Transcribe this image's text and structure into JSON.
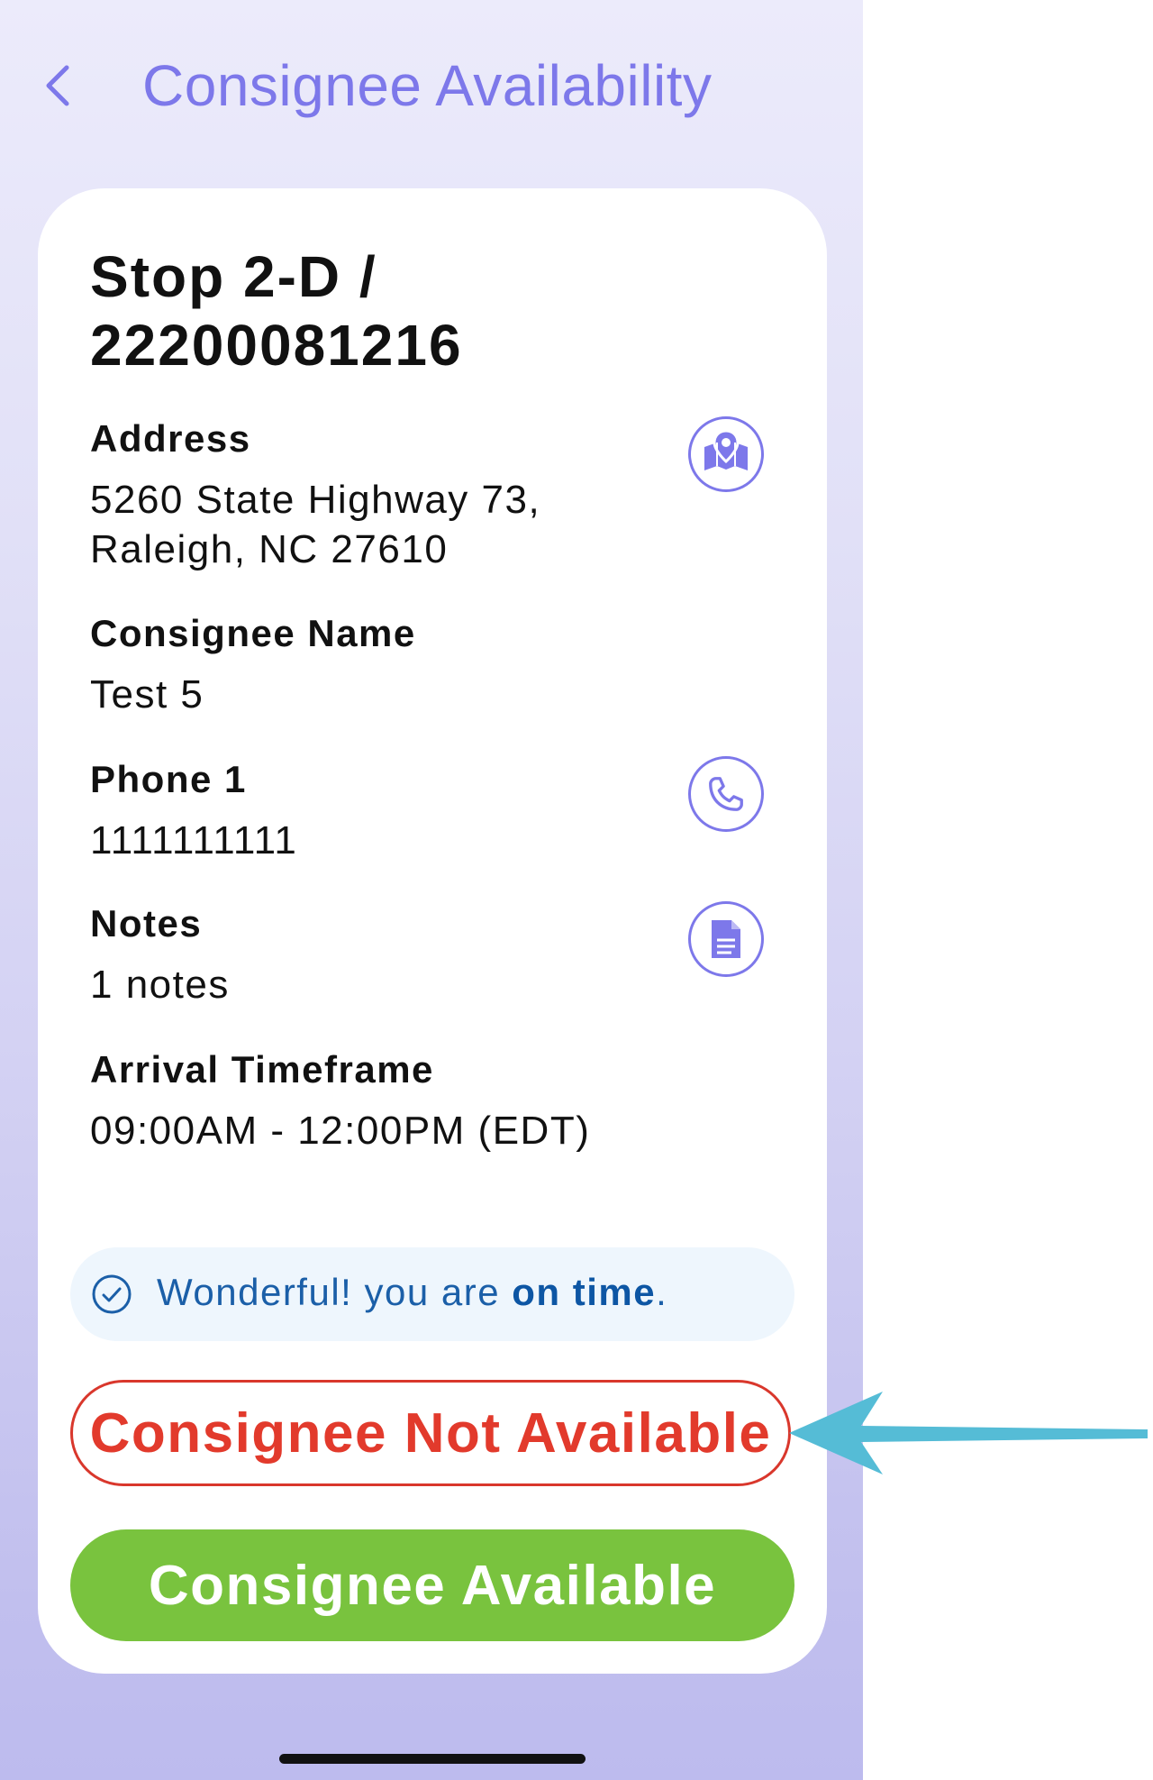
{
  "header": {
    "title": "Consignee Availability",
    "back_icon": "chevron-left-icon"
  },
  "stop": {
    "title_line1": "Stop 2-D /",
    "title_line2": "22200081216"
  },
  "address": {
    "label": "Address",
    "line1": "5260 State Highway 73,",
    "line2": "Raleigh, NC 27610",
    "icon": "map-pin-icon"
  },
  "consignee": {
    "label": "Consignee Name",
    "value": "Test 5"
  },
  "phone": {
    "label": "Phone 1",
    "value": "1111111111",
    "icon": "phone-icon"
  },
  "notes": {
    "label": "Notes",
    "value": "1 notes",
    "icon": "document-icon"
  },
  "arrival": {
    "label": "Arrival Timeframe",
    "value": "09:00AM - 12:00PM (EDT)"
  },
  "status": {
    "prefix": "Wonderful! you are ",
    "emphasis": "on time",
    "suffix": ".",
    "icon": "check-circle-icon"
  },
  "actions": {
    "not_available_label": "Consignee Not Available",
    "available_label": "Consignee Available"
  },
  "colors": {
    "accent": "#7d78ea",
    "danger": "#e23a2c",
    "success": "#79c33e",
    "info": "#1b5fa8",
    "annotation_arrow": "#55bcd6"
  }
}
